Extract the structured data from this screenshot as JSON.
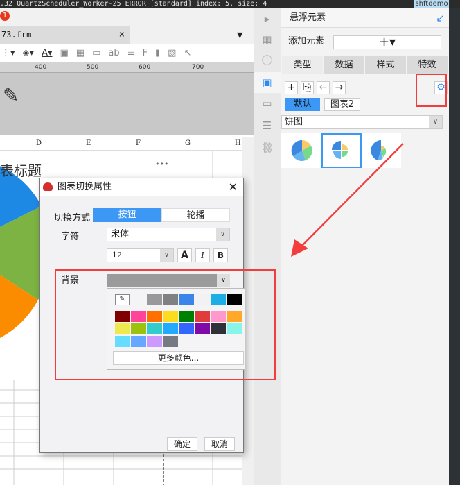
{
  "topbar": {
    "log": ".32 QuartzScheduler_Worker-25 ERROR [standard] index: 5, size: 4",
    "user": "shftdemo"
  },
  "notif_count": "1",
  "file_tab": {
    "name": "73.frm",
    "close": "×"
  },
  "ruler": [
    "400",
    "500",
    "600",
    "700"
  ],
  "columns": [
    "D",
    "E",
    "F",
    "G",
    "H"
  ],
  "chart_title": "表标题",
  "chart_menu": "•••",
  "panel": {
    "title": "悬浮元素",
    "add_label": "添加元素",
    "add_button": "+▾",
    "tabs": [
      "类型",
      "数据",
      "样式",
      "特效"
    ],
    "tags": [
      "默认",
      "图表2"
    ],
    "chart_type": "饼图"
  },
  "dialog": {
    "title": "图表切换属性",
    "switch_label": "切换方式",
    "switch_options": [
      "按钮",
      "轮播"
    ],
    "font_label": "字符",
    "font_value": "宋体",
    "size_value": "12",
    "style_buttons": [
      "A",
      "I",
      "B"
    ],
    "bg_label": "背景",
    "more_colors": "更多颜色...",
    "ok": "确定",
    "cancel": "取消"
  },
  "colors": {
    "accent": "#3d98f5",
    "annotation": "#f33d3d",
    "bg_value": "#9b9b9b",
    "recent": [
      "#999999",
      "#808080",
      "#3a85ea",
      "#f2f2f2",
      "#1eaee6",
      "#000000"
    ],
    "palette": [
      "#800000",
      "#ff4499",
      "#ff7000",
      "#fcdc1c",
      "#008000",
      "#e03c3c",
      "#ff99cc",
      "#ffa82a",
      "#eeea4e",
      "#9dc20e",
      "#33cccc",
      "#22aaff",
      "#3366ff",
      "#800aa8",
      "#303038",
      "#88f5e8",
      "#66dcff",
      "#66a8ff",
      "#cc99ff",
      "#767a82"
    ]
  }
}
